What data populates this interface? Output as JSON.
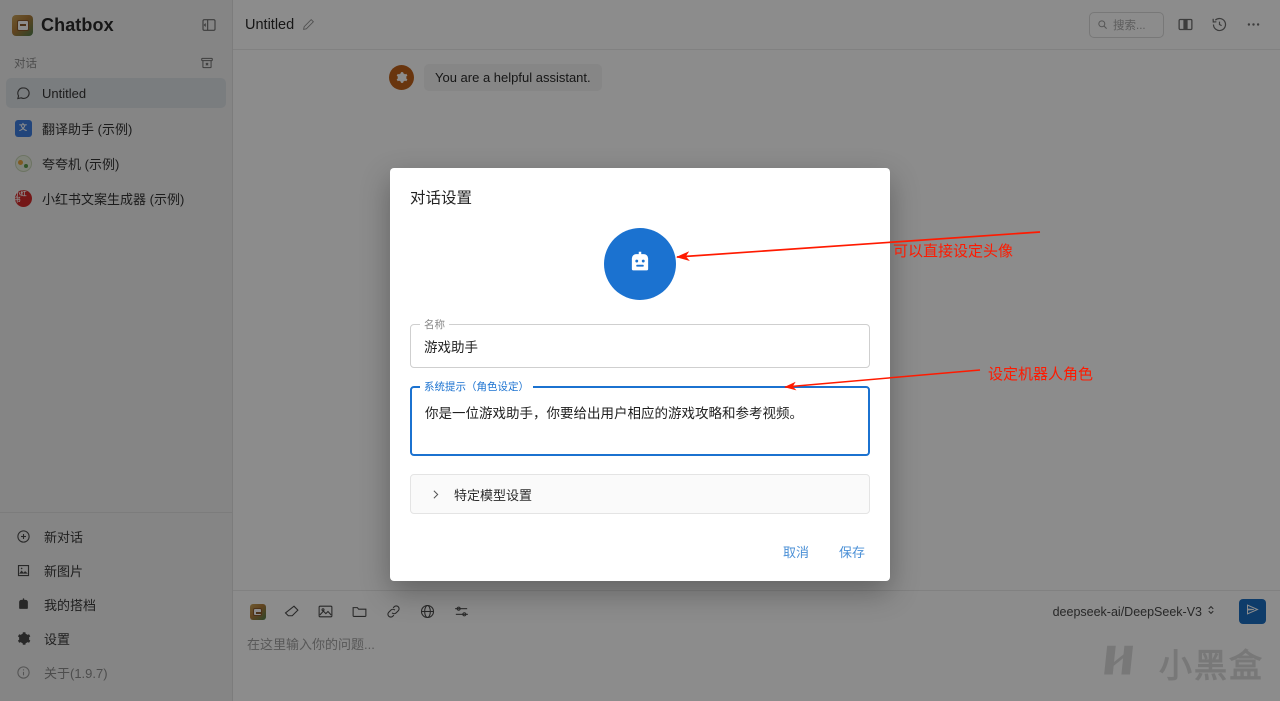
{
  "sidebar": {
    "brand": {
      "logo_icon": "chatbox-logo-icon",
      "title": "Chatbox"
    },
    "collapse_icon": "panel-collapse-icon",
    "section": {
      "label": "对话",
      "archive_icon": "archive-icon"
    },
    "conversations": [
      {
        "label": "Untitled",
        "icon": "chat-bubble-icon",
        "active": true
      },
      {
        "label": "翻译助手 (示例)",
        "icon": "translate-avatar-icon",
        "active": false
      },
      {
        "label": "夸夸机 (示例)",
        "icon": "praise-avatar-icon",
        "active": false
      },
      {
        "label": "小红书文案生成器 (示例)",
        "icon": "xiaohongshu-avatar-icon",
        "active": false
      }
    ],
    "bottom_items": [
      {
        "label": "新对话",
        "icon": "plus-circle-icon"
      },
      {
        "label": "新图片",
        "icon": "image-icon"
      },
      {
        "label": "我的搭档",
        "icon": "robot-icon"
      },
      {
        "label": "设置",
        "icon": "gear-icon"
      },
      {
        "label": "关于(1.9.7)",
        "icon": "info-circle-icon",
        "muted": true
      }
    ]
  },
  "topbar": {
    "title": "Untitled",
    "edit_icon": "pencil-icon",
    "search": {
      "placeholder": "搜索...",
      "icon": "search-icon"
    },
    "split_view_icon": "split-view-icon",
    "history_icon": "history-clock-icon",
    "more_icon": "more-horizontal-icon"
  },
  "chat": {
    "system_message": {
      "text": "You are a helpful assistant.",
      "avatar_icon": "gear-icon"
    }
  },
  "composer": {
    "tools": [
      "chatbox-logo-icon",
      "eraser-icon",
      "image-icon",
      "folder-icon",
      "link-icon",
      "globe-icon",
      "sliders-icon"
    ],
    "model": "deepseek-ai/DeepSeek-V3",
    "model_chevron_icon": "chevron-up-down-icon",
    "send_icon": "send-icon",
    "placeholder": "在这里输入你的问题..."
  },
  "watermark": {
    "mark_icon": "xiaoheihe-logo-icon",
    "text": "小黑盒"
  },
  "modal": {
    "title": "对话设置",
    "avatar_icon": "robot-avatar-icon",
    "avatar_color": "#1b72d0",
    "name_field": {
      "label": "名称",
      "value": "游戏助手"
    },
    "prompt_field": {
      "label": "系统提示（角色设定）",
      "value": "你是一位游戏助手，你要给出用户相应的游戏攻略和参考视频。",
      "focused": true
    },
    "accordion": {
      "label": "特定模型设置",
      "icon": "chevron-right-icon"
    },
    "cancel_label": "取消",
    "save_label": "保存"
  },
  "annotations": {
    "accent_color": "#ff1a00",
    "items": [
      {
        "text": "可以直接设定头像"
      },
      {
        "text": "设定机器人角色"
      }
    ]
  }
}
